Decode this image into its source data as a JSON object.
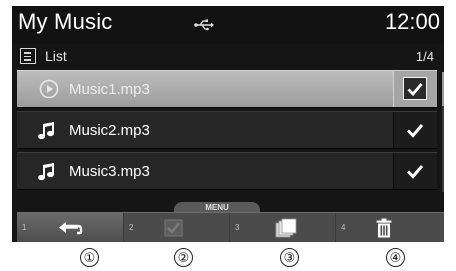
{
  "title_bar": {
    "title": "My Music",
    "source_icon": "usb-icon",
    "time": "12:00"
  },
  "subheader": {
    "icon": "list-icon",
    "label": "List",
    "page": "1/4"
  },
  "tracks": [
    {
      "name": "Music1.mp3",
      "icon": "play-circle-icon",
      "checked": true,
      "selected": true
    },
    {
      "name": "Music2.mp3",
      "icon": "music-note-icon",
      "checked": true,
      "selected": false
    },
    {
      "name": "Music3.mp3",
      "icon": "music-note-icon",
      "checked": true,
      "selected": false
    }
  ],
  "menu": {
    "tab_label": "MENU",
    "buttons": [
      {
        "number": "1",
        "icon": "back-arrow-icon",
        "active": true
      },
      {
        "number": "2",
        "icon": "check-icon",
        "active": false
      },
      {
        "number": "3",
        "icon": "copy-icon",
        "active": false
      },
      {
        "number": "4",
        "icon": "trash-icon",
        "active": false
      }
    ]
  },
  "callouts": [
    "①",
    "②",
    "③",
    "④"
  ],
  "colors": {
    "screen_bg": "#151515",
    "row_bg": "#262626",
    "selected_row_bg": "#b0b0b0",
    "menu_bar_bg": "#4b4b4b"
  }
}
